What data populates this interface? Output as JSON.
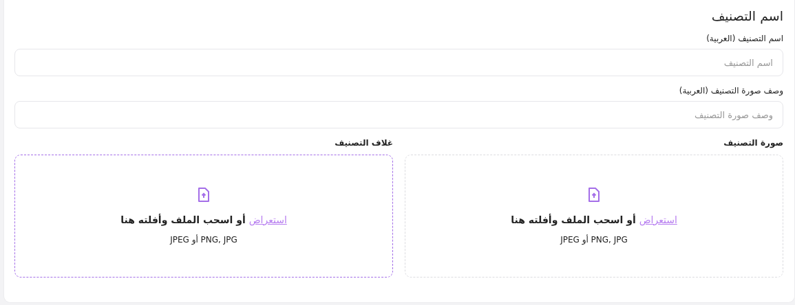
{
  "title": "اسم التصنيف",
  "fields": [
    {
      "label": "اسم التصنيف (العربية)",
      "placeholder": "اسم التصنيف"
    },
    {
      "label": "وصف صورة التصنيف (العربية)",
      "placeholder": "وصف صورة التصنيف"
    }
  ],
  "uploads": [
    {
      "label": "صورة التصنيف",
      "active": false,
      "link": "استعراض",
      "text": "أو اسحب الملف وأفلته هنا",
      "formats": "PNG, JPG أو JPEG"
    },
    {
      "label": "غلاف التصنيف",
      "active": true,
      "link": "استعراض",
      "text": "أو اسحب الملف وأفلته هنا",
      "formats": "PNG, JPG أو JPEG"
    }
  ]
}
